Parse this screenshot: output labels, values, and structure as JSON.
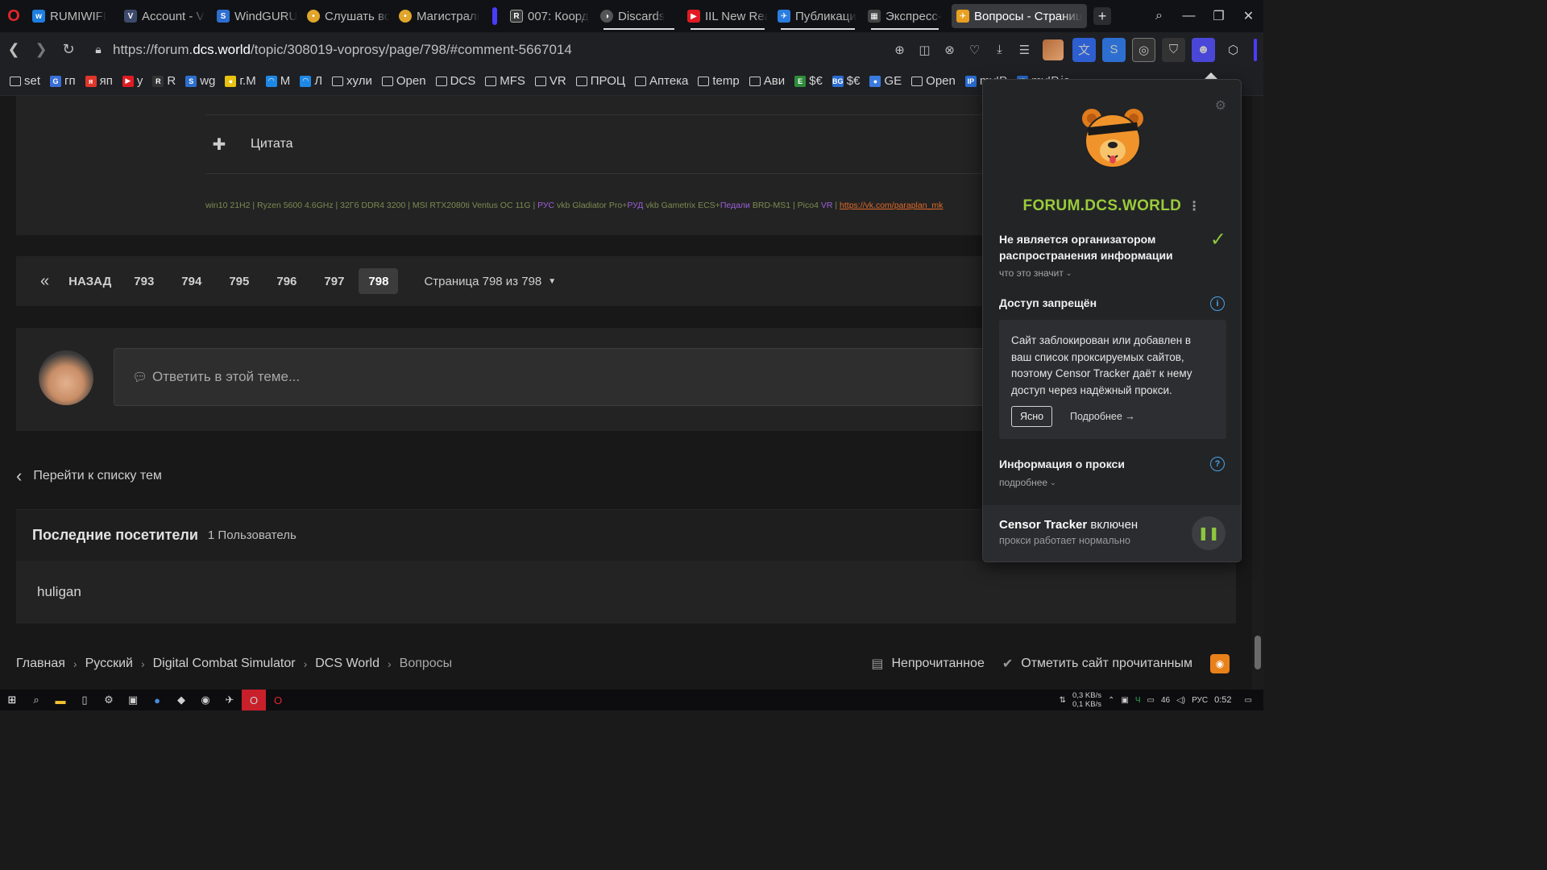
{
  "browser": {
    "tabs": [
      {
        "label": "RUMIWIFI",
        "fav_color": "#1e7fe0",
        "fav": "w"
      },
      {
        "label": "Account - V",
        "fav_color": "#3d4a6b",
        "fav": "V"
      },
      {
        "label": "WindGURU",
        "fav_color": "#2d6fd0",
        "fav": "S"
      },
      {
        "label": "Слушать вс",
        "fav_color": "#e0a52a",
        "fav": "•"
      },
      {
        "label": "Магистраль",
        "fav_color": "#e0a52a",
        "fav": "•"
      },
      {
        "label": "007: Коорд",
        "fav_color": "#3b3b3b",
        "fav": "R"
      },
      {
        "label": "Discards",
        "fav_color": "#555",
        "fav": "◑"
      },
      {
        "label": "IIL New Rea",
        "fav_color": "#e01b22",
        "fav": "▶"
      },
      {
        "label": "Публикаци",
        "fav_color": "#2a7de0",
        "fav": "✈"
      },
      {
        "label": "Экспресс-п",
        "fav_color": "#444",
        "fav": "▦"
      },
      {
        "label": "Вопросы - Страниц",
        "fav_color": "#e8a020",
        "fav": "✈"
      }
    ],
    "url_prefix": "https://forum.",
    "url_domain": "dcs.world",
    "url_path": "/topic/308019-voprosy/page/798/#comment-5667014",
    "bookmarks": [
      {
        "label": "set",
        "type": "folder"
      },
      {
        "label": "гп",
        "type": "site",
        "fav": "G",
        "color": "#3a6fd8"
      },
      {
        "label": "яп",
        "type": "site",
        "fav": "я",
        "color": "#e0362a"
      },
      {
        "label": "y",
        "type": "site",
        "fav": "▶",
        "color": "#e01b22"
      },
      {
        "label": "R",
        "type": "site",
        "fav": "R",
        "color": "#333"
      },
      {
        "label": "wg",
        "type": "site",
        "fav": "S",
        "color": "#2d6fd0"
      },
      {
        "label": "г.М",
        "type": "site",
        "fav": "●",
        "color": "#e8c210"
      },
      {
        "label": "М",
        "type": "site",
        "fav": "◠",
        "color": "#1e88e5"
      },
      {
        "label": "Л",
        "type": "site",
        "fav": "◠",
        "color": "#1e88e5"
      },
      {
        "label": "хули",
        "type": "folder"
      },
      {
        "label": "Open",
        "type": "folder"
      },
      {
        "label": "DCS",
        "type": "folder"
      },
      {
        "label": "MFS",
        "type": "folder"
      },
      {
        "label": "VR",
        "type": "folder"
      },
      {
        "label": "ПРОЦ",
        "type": "folder"
      },
      {
        "label": "Аптека",
        "type": "folder"
      },
      {
        "label": "temp",
        "type": "folder"
      },
      {
        "label": "Ави",
        "type": "folder"
      },
      {
        "label": "$€",
        "type": "site",
        "fav": "E",
        "color": "#2e8b3a"
      },
      {
        "label": "$€",
        "type": "site",
        "fav": "BG",
        "color": "#2a6cd0"
      },
      {
        "label": "GE",
        "type": "site",
        "fav": "●",
        "color": "#3b7be0"
      },
      {
        "label": "Open",
        "type": "folder"
      },
      {
        "label": "myIP",
        "type": "site",
        "fav": "IP",
        "color": "#2a6cd0"
      },
      {
        "label": "myIP.io",
        "type": "site",
        "fav": "IP",
        "color": "#2a6cd0"
      }
    ]
  },
  "forum": {
    "quote_label": "Цитата",
    "signature": {
      "part1": "win10 21H2 | Ryzen 5600 4.6GHz | 32Гб DDR4 3200 | MSI RTX2080ti Ventus OC 11G | ",
      "rus": "РУС",
      "part2": " vkb Gladiator Pro+",
      "rud": "РУД",
      "part3": " vkb Gametrix ECS+",
      "ped": "Педали",
      "part4": " BRD-MS1 | Pico4 ",
      "vr": "VR",
      "part5": " | ",
      "link": "https://vk.com/paraplan_mk"
    },
    "pagination": {
      "first": "«",
      "back": "НАЗАД",
      "pages": [
        "793",
        "794",
        "795",
        "796",
        "797",
        "798"
      ],
      "current": "798",
      "jump": "Страница 798 из 798"
    },
    "reply_placeholder": "Ответить в этой теме...",
    "back_to_list": "Перейти к списку тем",
    "visitors_title": "Последние посетители",
    "visitors_count": "1 Пользователь",
    "visitors": [
      "huligan"
    ],
    "breadcrumbs": [
      "Главная",
      "Русский",
      "Digital Combat Simulator",
      "DCS World",
      "Вопросы"
    ],
    "unread": "Непрочитанное",
    "mark_read": "Отметить сайт прочитанным"
  },
  "popup": {
    "domain": "FORUM.DCS.WORLD",
    "org_text": "Не является организатором распространения информации",
    "org_more": "что это значит",
    "access_title": "Доступ запрещён",
    "notice": "Сайт заблокирован или добавлен в ваш список проксируемых сайтов, поэтому Censor Tracker даёт к нему доступ через надёжный прокси.",
    "btn_ok": "Ясно",
    "btn_more": "Подробнее →",
    "proxy_title": "Информация о прокси",
    "proxy_more": "подробнее",
    "status_name": "Censor Tracker",
    "status_state": "включен",
    "status_sub": "прокси работает нормально",
    "accent": "#9acb3a"
  },
  "taskbar": {
    "net_up": "0,3 KB/s",
    "net_down": "0,1 KB/s",
    "battery": "46",
    "lang": "РУС",
    "time": "0:52"
  }
}
